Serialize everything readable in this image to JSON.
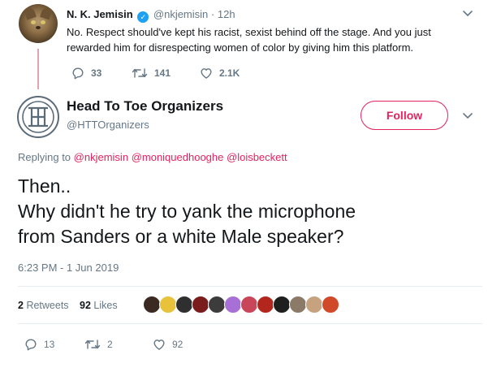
{
  "parent_tweet": {
    "name": "N. K. Jemisin",
    "verified_icon": "verified-badge-icon",
    "handle": "@nkjemisin",
    "separator": "·",
    "time": "12h",
    "text": "No. Respect should've kept his racist, sexist behind off the stage. And you just rewarded him for disrespecting women of color by giving him this platform.",
    "actions": {
      "replies": "33",
      "retweets": "141",
      "likes": "2.1K"
    }
  },
  "main_tweet": {
    "name": "Head To Toe Organizers",
    "handle": "@HTTOrganizers",
    "follow_label": "Follow",
    "replying_prefix": "Replying to",
    "mentions": [
      "@nkjemisin",
      "@moniquedhooghe",
      "@loisbeckett"
    ],
    "text_lines": [
      "Then..",
      "Why didn't he try to yank the microphone",
      "from Sanders or a white Male speaker?"
    ],
    "timestamp": "6:23 PM - 1 Jun 2019",
    "stats": {
      "retweets_count": "2",
      "retweets_label": "Retweets",
      "likes_count": "92",
      "likes_label": "Likes"
    },
    "liker_avatar_colors": [
      "#3b2a22",
      "#e8c23a",
      "#2f2f2f",
      "#7a1c1c",
      "#3c3c3c",
      "#a86fd6",
      "#c9455a",
      "#b3261e",
      "#1f1f1f",
      "#8c7a68",
      "#c7a27e",
      "#d04a2a"
    ],
    "actions": {
      "replies": "13",
      "retweets": "2",
      "likes": "92"
    }
  },
  "colors": {
    "accent": "#e0245e",
    "muted": "#657786",
    "verified": "#1da1f2",
    "retweet_green": "#17bf63"
  }
}
